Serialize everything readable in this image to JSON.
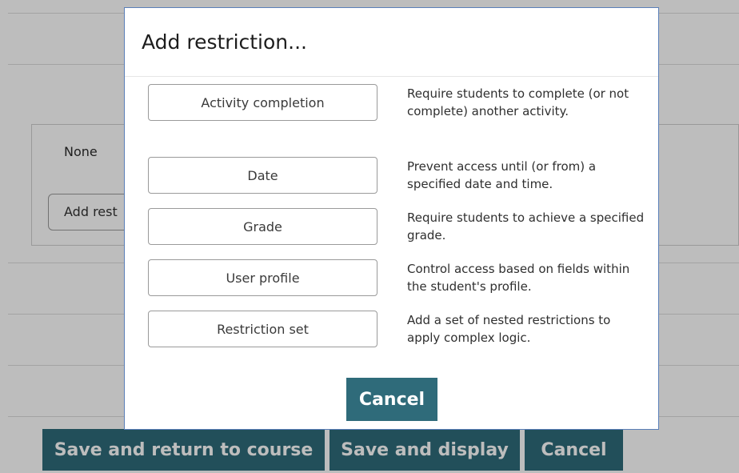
{
  "background": {
    "availability_value": "None",
    "add_restriction_label": "Add rest",
    "footer": {
      "save_return_label": "Save and return to course",
      "save_display_label": "Save and display",
      "cancel_label": "Cancel"
    }
  },
  "modal": {
    "title": "Add restriction...",
    "options": [
      {
        "label": "Activity completion",
        "description": "Require students to complete (or not complete) another activity."
      },
      {
        "label": "Date",
        "description": "Prevent access until (or from) a specified date and time."
      },
      {
        "label": "Grade",
        "description": "Require students to achieve a specified grade."
      },
      {
        "label": "User profile",
        "description": "Control access based on fields within the student's profile."
      },
      {
        "label": "Restriction set",
        "description": "Add a set of nested restrictions to apply complex logic."
      }
    ],
    "cancel_label": "Cancel"
  },
  "colors": {
    "primary_button": "#2f6b7a",
    "modal_border": "#5a7fb8",
    "overlay": "rgba(0,0,0,0.26)"
  }
}
